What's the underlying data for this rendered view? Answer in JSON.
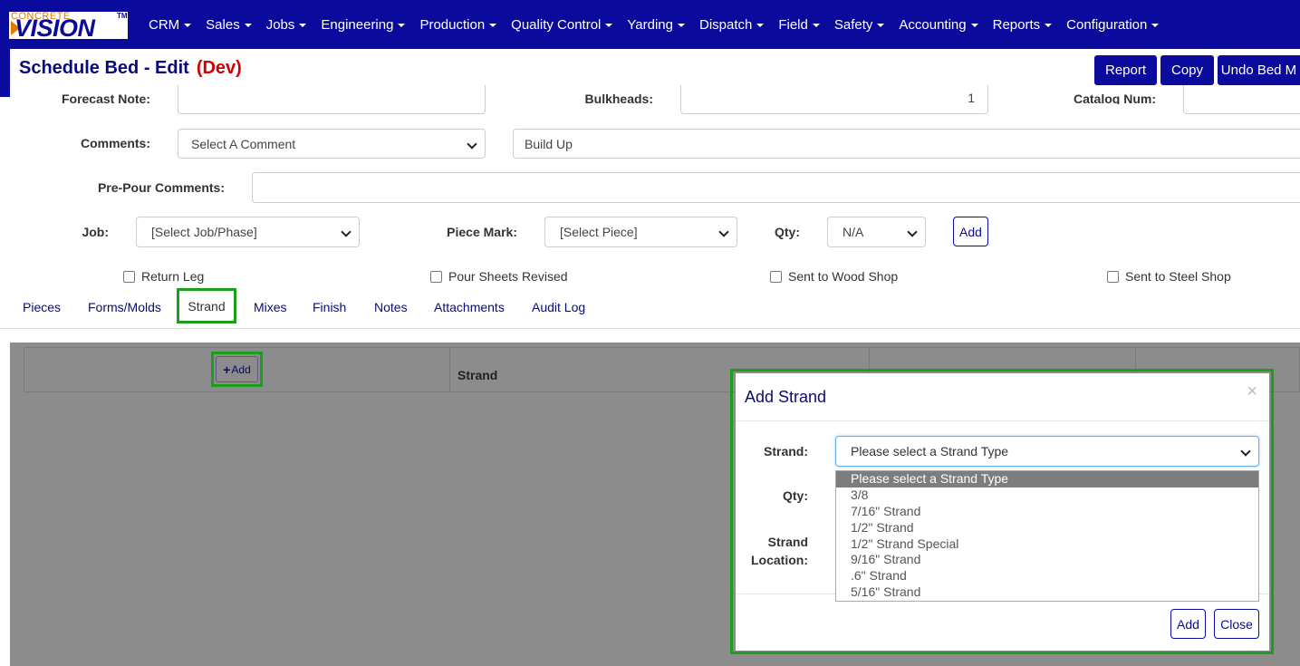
{
  "logo": {
    "small_text": "CONCRETE",
    "big_text": "VISION",
    "tm": "TM"
  },
  "nav": {
    "items": [
      "CRM",
      "Sales",
      "Jobs",
      "Engineering",
      "Production",
      "Quality Control",
      "Yarding",
      "Dispatch",
      "Field",
      "Safety",
      "Accounting",
      "Reports",
      "Configuration"
    ]
  },
  "header": {
    "title": "Schedule Bed - Edit",
    "env": "(Dev)",
    "buttons": {
      "report": "Report",
      "copy": "Copy",
      "undo": "Undo Bed M"
    }
  },
  "form": {
    "forecast_note_label": "Forecast Note:",
    "bulkheads_label": "Bulkheads:",
    "bulkheads_value": "1",
    "catalog_num_label": "Catalog Num:",
    "comments_label": "Comments:",
    "comments_select": "Select A Comment",
    "comments_value": "Build Up",
    "pre_pour_label": "Pre-Pour Comments:",
    "job_label": "Job:",
    "job_select": "[Select Job/Phase]",
    "piece_mark_label": "Piece Mark:",
    "piece_mark_select": "[Select Piece]",
    "qty_label": "Qty:",
    "qty_select": "N/A",
    "add_button": "Add",
    "checkboxes": {
      "return_leg": "Return Leg",
      "pour_sheets": "Pour Sheets Revised",
      "wood_shop": "Sent to Wood Shop",
      "steel_shop": "Sent to Steel Shop"
    }
  },
  "tabs": {
    "pieces": "Pieces",
    "forms": "Forms/Molds",
    "strand": "Strand",
    "mixes": "Mixes",
    "finish": "Finish",
    "notes": "Notes",
    "attachments": "Attachments",
    "audit": "Audit Log"
  },
  "grid": {
    "add_button": "Add",
    "strand_header": "Strand"
  },
  "modal": {
    "title": "Add Strand",
    "close_symbol": "×",
    "strand_label": "Strand:",
    "qty_label": "Qty:",
    "location_label_1": "Strand",
    "location_label_2": "Location:",
    "select_value": "Please select a Strand Type",
    "options": [
      "Please select a Strand Type",
      "3/8",
      "7/16\" Strand",
      "1/2\" Strand",
      "1/2\" Strand Special",
      "9/16\" Strand",
      ".6\" Strand",
      "5/16\" Strand"
    ],
    "add_button": "Add",
    "close_button": "Close"
  },
  "colors": {
    "navbar": "#0a0a9c",
    "highlight": "#1b9e1b",
    "dev": "#d40000",
    "overlay": "#8c8c8c"
  }
}
